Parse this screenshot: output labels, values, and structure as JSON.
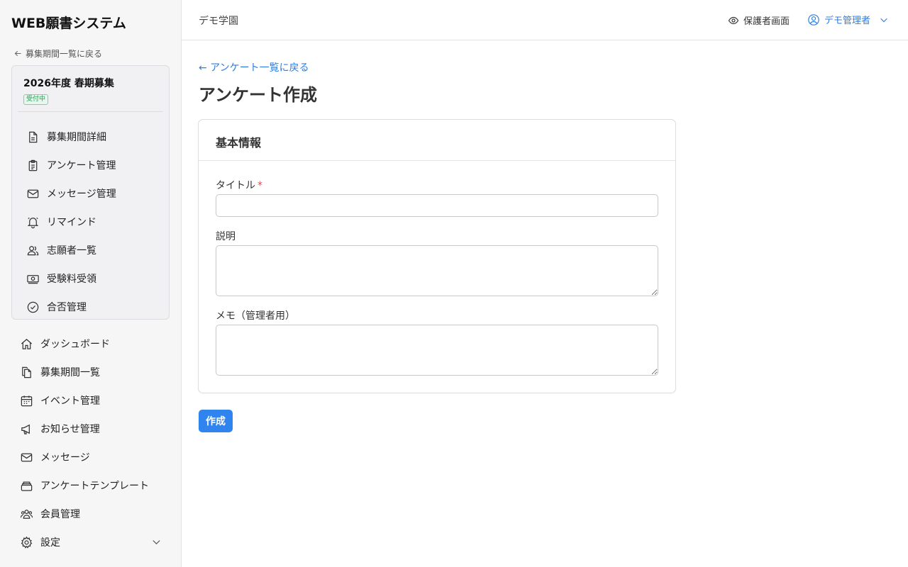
{
  "app": {
    "title": "WEB願書システム"
  },
  "sidebar": {
    "back_label": "募集期間一覧に戻る",
    "period": {
      "name": "2026年度 春期募集",
      "status": "受付中"
    },
    "sub_items": [
      {
        "label": "募集期間詳細",
        "icon": "document-icon"
      },
      {
        "label": "アンケート管理",
        "icon": "clipboard-icon"
      },
      {
        "label": "メッセージ管理",
        "icon": "mail-icon"
      },
      {
        "label": "リマインド",
        "icon": "bell-icon"
      },
      {
        "label": "志願者一覧",
        "icon": "users-icon"
      },
      {
        "label": "受験料受領",
        "icon": "money-icon"
      },
      {
        "label": "合否管理",
        "icon": "check-circle-icon"
      }
    ],
    "main_items": [
      {
        "label": "ダッシュボード",
        "icon": "home-icon"
      },
      {
        "label": "募集期間一覧",
        "icon": "documents-icon"
      },
      {
        "label": "イベント管理",
        "icon": "calendar-icon"
      },
      {
        "label": "お知らせ管理",
        "icon": "megaphone-icon"
      },
      {
        "label": "メッセージ",
        "icon": "mail-icon"
      },
      {
        "label": "アンケートテンプレート",
        "icon": "stack-icon"
      },
      {
        "label": "会員管理",
        "icon": "user-group-icon"
      },
      {
        "label": "設定",
        "icon": "gear-icon"
      }
    ]
  },
  "header": {
    "school_name": "デモ学園",
    "guardian_view_label": "保護者画面",
    "user_name": "デモ管理者"
  },
  "main": {
    "back_label": "← アンケート一覧に戻る",
    "page_title": "アンケート作成",
    "card_title": "基本情報",
    "fields": {
      "title_label": "タイトル",
      "title_required_mark": "*",
      "title_value": "",
      "description_label": "説明",
      "description_value": "",
      "memo_label": "メモ（管理者用）",
      "memo_value": ""
    },
    "submit_label": "作成"
  },
  "colors": {
    "accent": "#2f84f0",
    "link": "#2f7de1",
    "required": "#e5484d",
    "badge_green": "#1f9d55"
  }
}
